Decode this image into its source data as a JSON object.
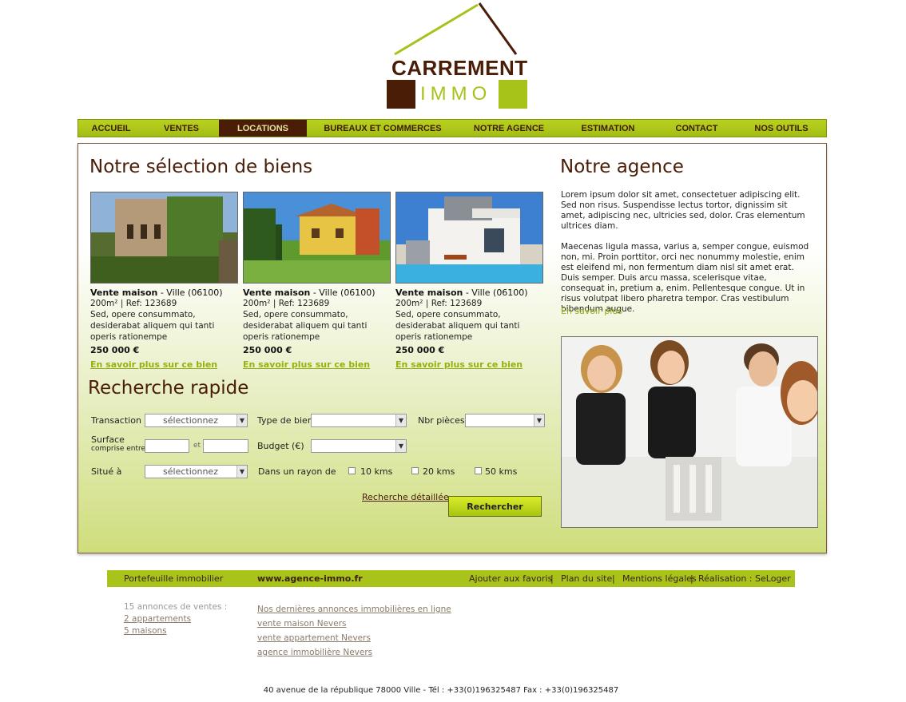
{
  "logo": {
    "brand": "CARREMENT",
    "sub": "IMMO"
  },
  "nav": [
    {
      "label": "ACCUEIL",
      "active": false
    },
    {
      "label": "VENTES",
      "active": false
    },
    {
      "label": "LOCATIONS",
      "active": true
    },
    {
      "label": "BUREAUX ET COMMERCES",
      "active": false
    },
    {
      "label": "NOTRE AGENCE",
      "active": false
    },
    {
      "label": "ESTIMATION",
      "active": false
    },
    {
      "label": "CONTACT",
      "active": false
    },
    {
      "label": "NOS OUTILS",
      "active": false
    }
  ],
  "selection": {
    "title": "Notre sélection de biens",
    "properties": [
      {
        "type": "Vente maison",
        "city": " - Ville (06100)",
        "details": "200m² | Ref: 123689",
        "desc": "Sed, opere consummato, desiderabat aliquem qui tanti operis rationempe",
        "price": "250 000 €",
        "more": "En savoir plus sur ce bien"
      },
      {
        "type": "Vente maison",
        "city": " - Ville (06100)",
        "details": "200m² | Ref: 123689",
        "desc": "Sed, opere consummato, desiderabat aliquem qui tanti operis rationempe",
        "price": "250 000 €",
        "more": "En savoir plus sur ce bien"
      },
      {
        "type": "Vente maison",
        "city": " - Ville (06100)",
        "details": "200m² | Ref: 123689",
        "desc": "Sed, opere consummato, desiderabat aliquem qui tanti operis rationempe",
        "price": "250 000 €",
        "more": "En savoir plus sur ce bien"
      }
    ]
  },
  "search": {
    "title": "Recherche rapide",
    "transaction_label": "Transaction",
    "transaction_value": "sélectionnez",
    "type_label": "Type de bien",
    "type_value": "",
    "rooms_label": "Nbr pièces",
    "rooms_value": "",
    "surface_label": "Surface",
    "surface_sub": "comprise entre",
    "surface_and": "et",
    "budget_label": "Budget (€)",
    "budget_value": "",
    "location_label": "Situé à",
    "location_value": "sélectionnez",
    "radius_label": "Dans un rayon de",
    "radius_options": [
      "10 kms",
      "20 kms",
      "50 kms"
    ],
    "detailed_link": "Recherche détaillée",
    "submit": "Rechercher"
  },
  "agence": {
    "title": "Notre agence",
    "p1": "Lorem ipsum dolor sit amet, consectetuer adipiscing elit. Sed non risus. Suspendisse lectus tortor, dignissim sit amet, adipiscing nec, ultricies sed, dolor. Cras elementum ultrices diam.",
    "p2": "Maecenas ligula massa, varius a, semper congue, euismod non, mi. Proin porttitor, orci nec nonummy molestie, enim est eleifend mi, non fermentum diam nisl sit amet erat. Duis semper. Duis arcu massa, scelerisque vitae, consequat in, pretium a, enim. Pellentesque congue. Ut in risus volutpat libero pharetra tempor. Cras vestibulum bibendum augue.",
    "more": "En savoir plus"
  },
  "footer": {
    "portfolio": "Portefeuille immobilier",
    "site": "www.agence-immo.fr",
    "links": [
      "Ajouter aux favoris",
      "Plan du site",
      "Mentions légales",
      "Réalisation : SeLoger"
    ],
    "sep": "|",
    "annonces_title": "15 annonces de ventes :",
    "annonces_links": [
      "2 appartements",
      "5 maisons"
    ],
    "seo_links": [
      "Nos dernières annonces immobilières en ligne",
      "vente maison Nevers",
      "vente appartement Nevers",
      "agence immobilière Nevers"
    ],
    "address": "40 avenue de la république  78000 Ville   -  Tél : +33(0)196325487 Fax : +33(0)196325487"
  },
  "colors": {
    "brown": "#4a1d07",
    "green": "#a7c31a"
  }
}
